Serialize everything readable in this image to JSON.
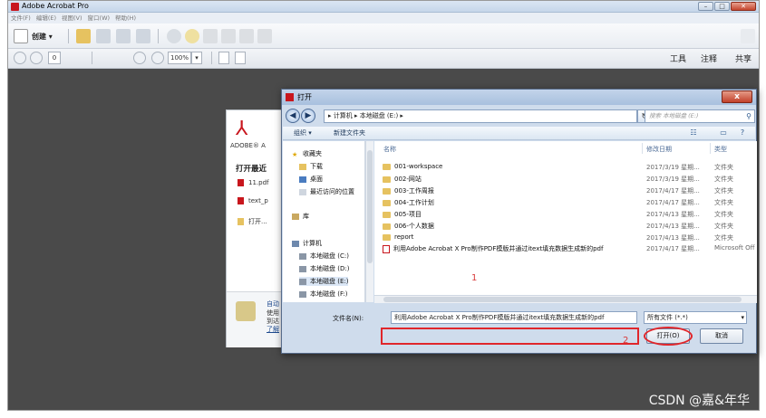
{
  "window": {
    "title": "Adobe Acrobat Pro"
  },
  "menu": [
    "文件(F)",
    "编辑(E)",
    "视图(V)",
    "窗口(W)",
    "帮助(H)"
  ],
  "toolbar": {
    "create_label": "创建 ▾",
    "zoom_value": "100%",
    "page_value": "0",
    "tools_label": "工具",
    "sign_label": "注释",
    "share_label": "共享"
  },
  "startpage": {
    "brand": "ADOBE® A",
    "open_recent": "打开最近",
    "recent": [
      "11.pdf",
      "text_p",
      "打开..."
    ],
    "bottom_lines": [
      "自动",
      "使用",
      "到达",
      "了解"
    ]
  },
  "dialog": {
    "title": "打开",
    "close": "x",
    "address": "▸ 计算机 ▸ 本地磁盘 (E:) ▸",
    "refresh": "↻",
    "search_placeholder": "搜索 本地磁盘 (E:)",
    "organize": "组织 ▾",
    "new_folder": "新建文件夹",
    "nav": {
      "favorites": "收藏夹",
      "downloads": "下载",
      "desktop": "桌面",
      "recent": "最近访问的位置",
      "libraries": "库",
      "computer": "计算机",
      "drives": [
        "本地磁盘 (C:)",
        "本地磁盘 (D:)",
        "本地磁盘 (E:)",
        "本地磁盘 (F:)"
      ]
    },
    "columns": {
      "name": "名称",
      "date": "修改日期",
      "type": "类型"
    },
    "rows": [
      {
        "name": "001-workspace",
        "date": "2017/3/19 星期...",
        "type": "文件夹",
        "kind": "folder"
      },
      {
        "name": "002-网站",
        "date": "2017/3/19 星期...",
        "type": "文件夹",
        "kind": "folder"
      },
      {
        "name": "003-工作周报",
        "date": "2017/4/17 星期...",
        "type": "文件夹",
        "kind": "folder"
      },
      {
        "name": "004-工作计划",
        "date": "2017/4/17 星期...",
        "type": "文件夹",
        "kind": "folder"
      },
      {
        "name": "005-项目",
        "date": "2017/4/13 星期...",
        "type": "文件夹",
        "kind": "folder"
      },
      {
        "name": "006-个人数据",
        "date": "2017/4/13 星期...",
        "type": "文件夹",
        "kind": "folder"
      },
      {
        "name": "report",
        "date": "2017/4/13 星期...",
        "type": "文件夹",
        "kind": "folder"
      },
      {
        "name": "利用Adobe Acrobat X Pro制作PDF模版并通过itext填充数据生成新的pdf",
        "date": "2017/4/17 星期...",
        "type": "Microsoft Off",
        "kind": "pdf"
      }
    ],
    "filename_label": "文件名(N):",
    "filename_value": "利用Adobe Acrobat X Pro制作PDF模版并通过itext填充数据生成新的pdf",
    "filetype_value": "所有文件 (*.*)",
    "open_button": "打开(O)",
    "cancel_button": "取消",
    "marks": [
      "1",
      "2"
    ]
  },
  "watermark": "CSDN @嘉&年华",
  "colors": {
    "accent_red": "#e0262b",
    "acrobat_red": "#c8161d",
    "workspace": "#4a4a4a"
  }
}
